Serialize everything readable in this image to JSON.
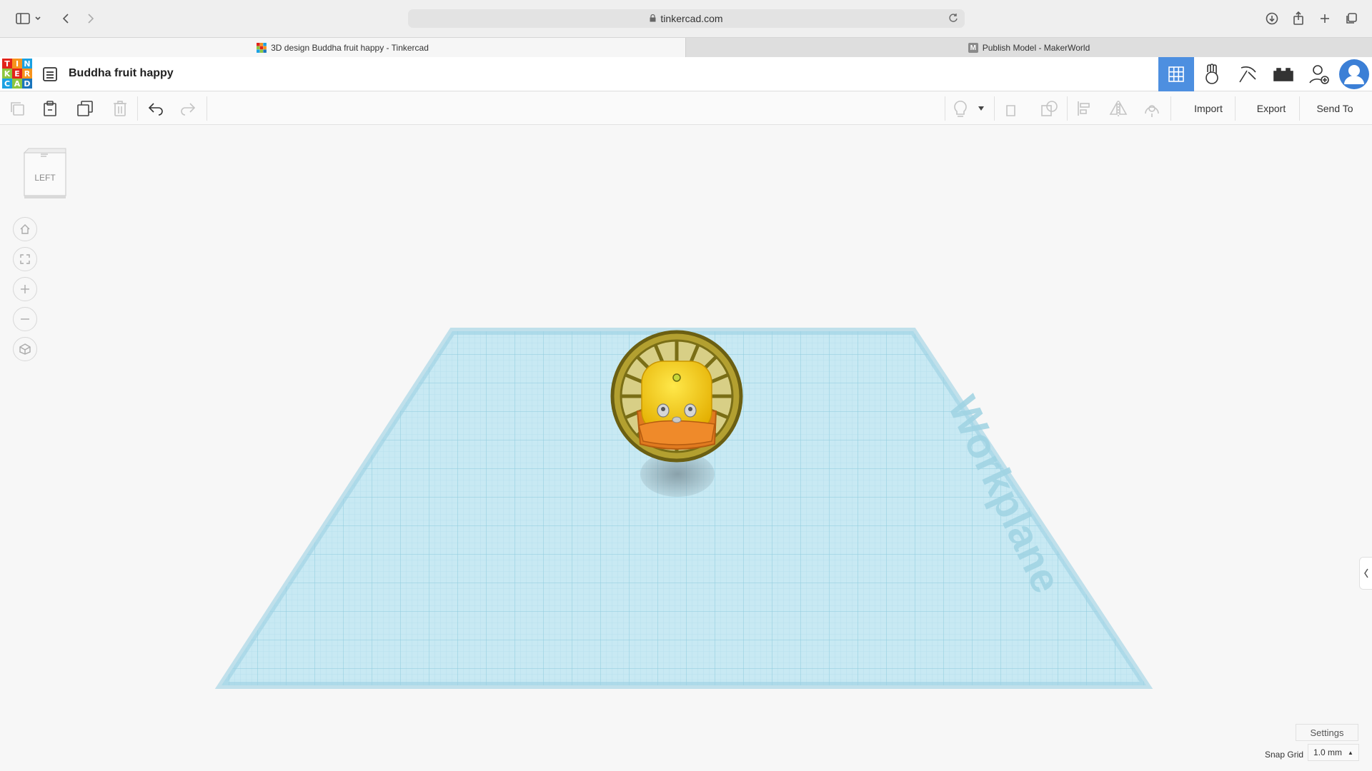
{
  "browser": {
    "url": "tinkercad.com",
    "tabs": [
      {
        "label": "3D design Buddha fruit happy - Tinkercad",
        "active": true
      },
      {
        "label": "Publish Model - MakerWorld",
        "active": false
      }
    ]
  },
  "logo": {
    "letters": [
      "T",
      "I",
      "N",
      "K",
      "E",
      "R",
      "C",
      "A",
      "D"
    ],
    "colors": [
      "#e2231a",
      "#f7941d",
      "#1ba1e2",
      "#8dc63f",
      "#e2231a",
      "#f7941d",
      "#1ba1e2",
      "#8dc63f",
      "#1b75bc"
    ]
  },
  "header": {
    "design_title": "Buddha fruit happy"
  },
  "toolbar": {
    "import_label": "Import",
    "export_label": "Export",
    "send_to_label": "Send To"
  },
  "viewport": {
    "viewcube_label": "LEFT",
    "workplane_label": "Workplane",
    "settings_label": "Settings",
    "snap_grid_label": "Snap Grid",
    "snap_grid_value": "1.0 mm"
  },
  "colors": {
    "accent": "#4d8fe0",
    "workplane": "#b9e2ee",
    "fruit": "#f2c20a",
    "robe": "#e07a1f",
    "halo": "#8a7a18"
  }
}
